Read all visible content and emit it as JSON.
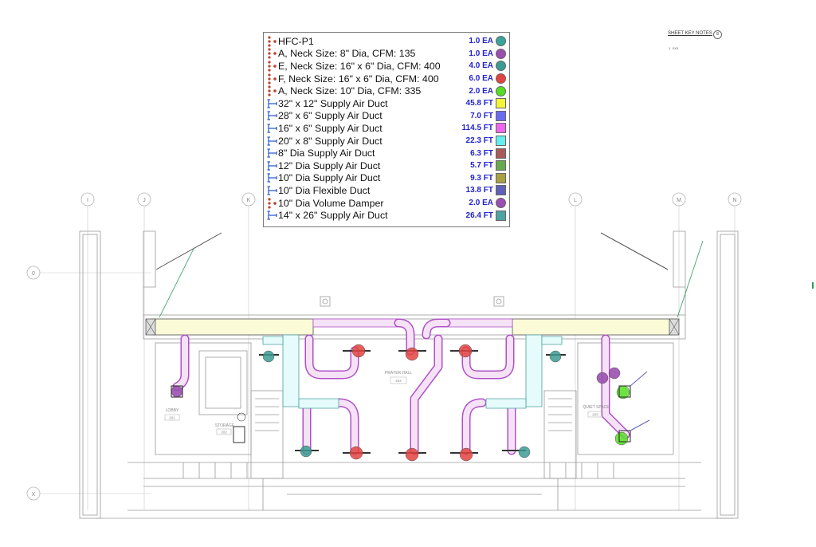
{
  "legend": {
    "rows": [
      {
        "label": "HFC-P1",
        "qty": "1.0 EA",
        "color": "#3aa39a",
        "swatch": "circle",
        "icon": "damper-dots-icon"
      },
      {
        "label": "A, Neck Size: 8\" Dia, CFM: 135",
        "qty": "1.0 EA",
        "color": "#9b4fb0",
        "swatch": "circle",
        "icon": "damper-dots-icon"
      },
      {
        "label": "E, Neck Size: 16\" x 6\" Dia, CFM: 400",
        "qty": "4.0 EA",
        "color": "#3c9b93",
        "swatch": "circle",
        "icon": "damper-dots-icon"
      },
      {
        "label": "F, Neck Size: 16\" x 6\" Dia, CFM: 400",
        "qty": "6.0 EA",
        "color": "#e2433f",
        "swatch": "circle",
        "icon": "damper-dots-icon"
      },
      {
        "label": "A, Neck Size: 10\" Dia, CFM: 335",
        "qty": "2.0 EA",
        "color": "#55dd22",
        "swatch": "circle",
        "icon": "damper-dots-icon"
      },
      {
        "label": "32\" x 12\" Supply Air Duct",
        "qty": "45.8 FT",
        "color": "#f4f43a",
        "swatch": "square",
        "icon": "duct-length-icon"
      },
      {
        "label": "28\" x 6\" Supply Air Duct",
        "qty": "7.0 FT",
        "color": "#6b6bef",
        "swatch": "square",
        "icon": "duct-length-icon"
      },
      {
        "label": "16\" x 6\" Supply Air Duct",
        "qty": "114.5 FT",
        "color": "#ee66ee",
        "swatch": "square",
        "icon": "duct-length-icon"
      },
      {
        "label": "20\" x 8\" Supply Air Duct",
        "qty": "22.3 FT",
        "color": "#66eeee",
        "swatch": "square",
        "icon": "duct-length-icon"
      },
      {
        "label": "8\" Dia Supply Air Duct",
        "qty": "6.3 FT",
        "color": "#a85a5a",
        "swatch": "square",
        "icon": "duct-length-icon"
      },
      {
        "label": "12\" Dia Supply Air Duct",
        "qty": "5.7 FT",
        "color": "#6aa84f",
        "swatch": "square",
        "icon": "duct-length-icon"
      },
      {
        "label": "10\" Dia Supply Air Duct",
        "qty": "9.3 FT",
        "color": "#a8a045",
        "swatch": "square",
        "icon": "duct-length-icon"
      },
      {
        "label": "10\" Dia Flexible Duct",
        "qty": "13.8 FT",
        "color": "#6060b8",
        "swatch": "square",
        "icon": "duct-length-icon"
      },
      {
        "label": "10\" Dia Volume Damper",
        "qty": "2.0 EA",
        "color": "#9b4fb0",
        "swatch": "circle",
        "icon": "damper-dots-icon"
      },
      {
        "label": "14\" x 26\" Supply Air Duct",
        "qty": "26.4 FT",
        "color": "#4fa3a3",
        "swatch": "square",
        "icon": "duct-length-icon"
      }
    ]
  },
  "sheet": {
    "notes_title": "SHEET KEY NOTES",
    "notes_badge": "8",
    "notes_item": "1. XXX"
  },
  "grid": {
    "top_labels": [
      "I",
      "J",
      "K",
      "L",
      "M",
      "N"
    ],
    "side_labels": [
      "0",
      "X"
    ]
  },
  "rooms": {
    "lobby": "LOBBY",
    "lobby_num": "201",
    "storage": "STORAGE",
    "storage_num": "202",
    "prayer_hall": "PRAYER HALL",
    "prayer_hall_num": "204",
    "quiet_space": "QUIET SPACE",
    "quiet_space_num": "203"
  },
  "colors": {
    "duct_fill": "#f6e2f6",
    "duct_stroke": "#b050c8",
    "main_duct_fill": "#fbfbd8",
    "wall": "#9a9a9a",
    "text_blue": "#2222cc"
  }
}
